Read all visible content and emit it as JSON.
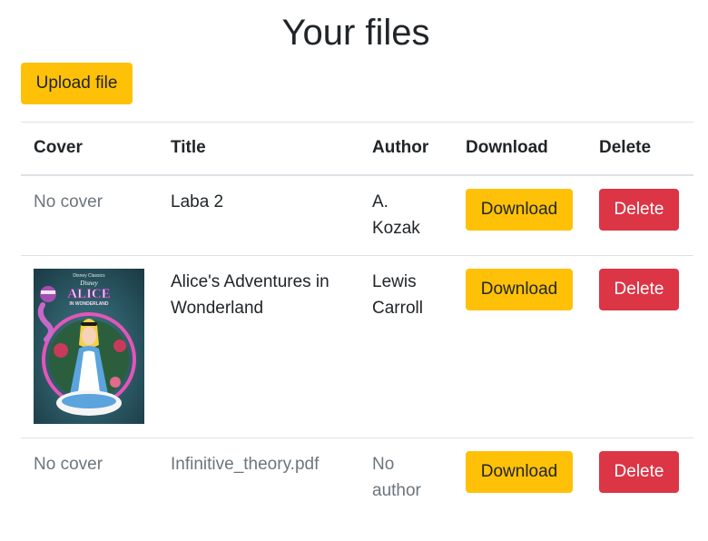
{
  "page": {
    "title": "Your files",
    "upload_label": "Upload file"
  },
  "table": {
    "columns": [
      "Cover",
      "Title",
      "Author",
      "Download",
      "Delete"
    ],
    "rows": [
      {
        "cover": "No cover",
        "title": "Laba 2",
        "author": "A. Kozak",
        "download_label": "Download",
        "delete_label": "Delete"
      },
      {
        "cover": "",
        "cover_art": {
          "series": "Disney Classics",
          "brand": "Disney",
          "title": "ALICE",
          "subtitle": "IN WONDERLAND"
        },
        "title": "Alice's Adventures in Wonderland",
        "author": "Lewis Carroll",
        "download_label": "Download",
        "delete_label": "Delete"
      },
      {
        "cover": "No cover",
        "title": "Infinitive_theory.pdf",
        "author": "No author",
        "download_label": "Download",
        "delete_label": "Delete"
      }
    ]
  },
  "colors": {
    "warning": "#ffc107",
    "danger": "#dc3545",
    "muted": "#6c757d",
    "border": "#dee2e6",
    "text": "#212529"
  }
}
